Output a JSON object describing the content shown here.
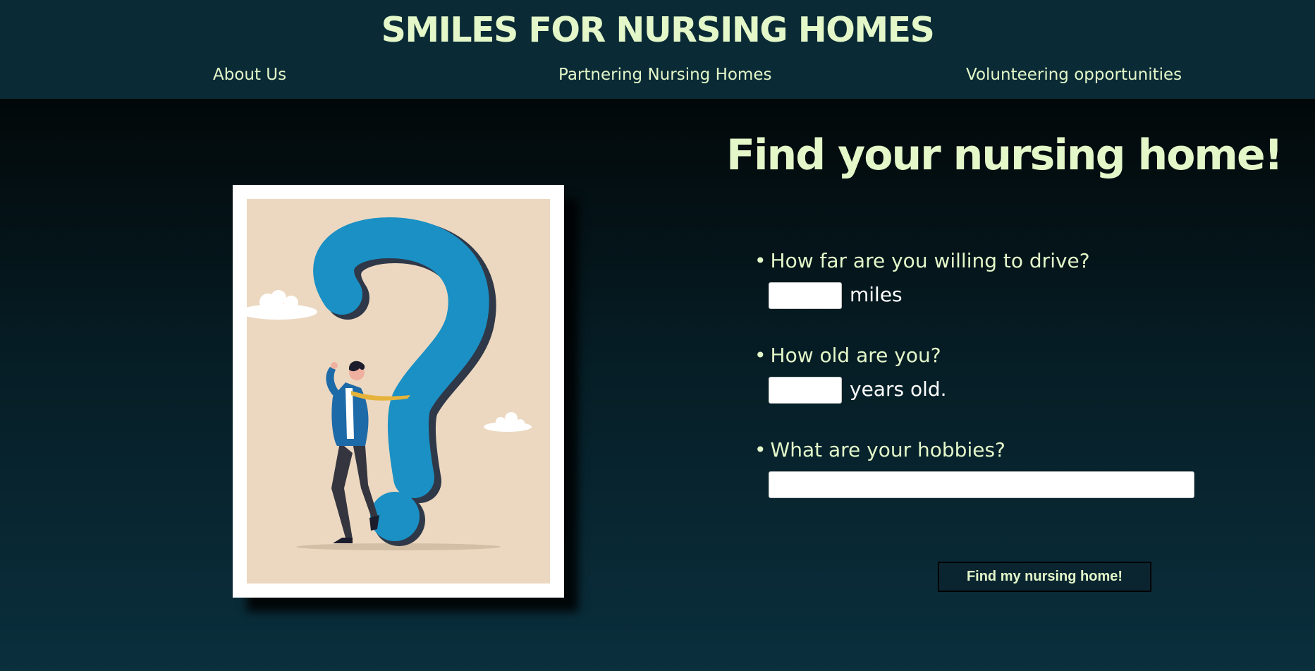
{
  "header": {
    "title": "SMILES FOR NURSING HOMES",
    "nav": [
      {
        "label": "About Us"
      },
      {
        "label": "Partnering Nursing Homes"
      },
      {
        "label": "Volunteering opportunities"
      }
    ]
  },
  "main": {
    "heading": "Find your nursing home!",
    "illustration": "person-with-question-mark",
    "form": {
      "bullet": "•",
      "distance": {
        "question": "How far are you willing to drive?",
        "value": "",
        "unit": "miles"
      },
      "age": {
        "question": "How old are you?",
        "value": "",
        "unit": "years old."
      },
      "hobbies": {
        "question": "What are your hobbies?",
        "value": ""
      },
      "submit_label": "Find my nursing home!"
    }
  },
  "colors": {
    "header_bg": "#0a2a35",
    "accent_text": "#e3f7c9",
    "poster_bg": "#ecd8c0",
    "question_blue": "#1a90c4"
  }
}
